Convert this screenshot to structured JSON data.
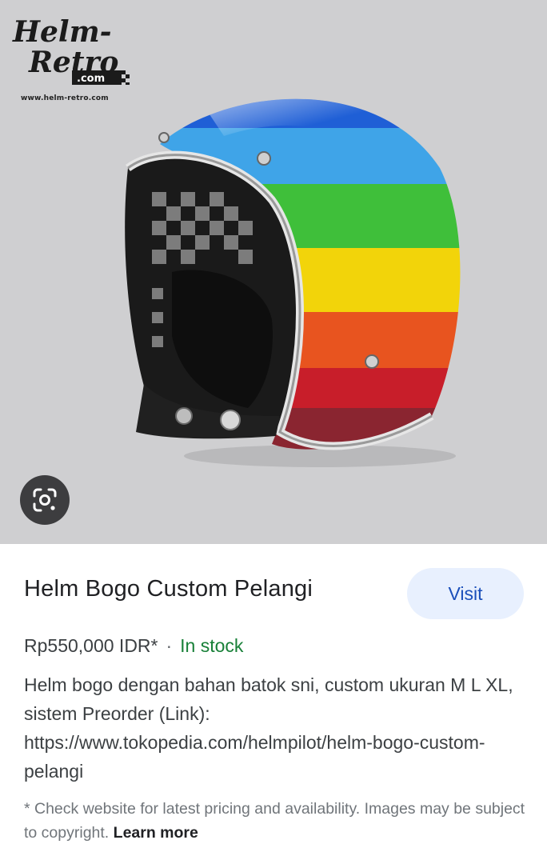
{
  "image": {
    "logo_text_line1": "Helm-",
    "logo_text_line2": "Retro",
    "logo_text_com": ".com",
    "logo_url": "www.helm-retro.com",
    "lens_icon": "google-lens-icon"
  },
  "result": {
    "title": "Helm Bogo Custom Pelangi",
    "visit_label": "Visit",
    "price": "Rp550,000 IDR*",
    "separator": "·",
    "stock": "In stock",
    "description": "Helm bogo dengan bahan batok sni, custom ukuran M L XL, sistem Preorder (Link): https://www.tokopedia.com/helmpilot/helm-bogo-custom-pelangi",
    "disclaimer": "* Check website for latest pricing and availability. Images may be subject to copyright.",
    "learn_more": "Learn more"
  },
  "colors": {
    "image_background": "#cfcfd1",
    "visit_button_bg": "#e8f0fe",
    "visit_button_text": "#1a4fba",
    "in_stock": "#188038",
    "helmet_stripes": [
      "#1f5fd6",
      "#3fa4e8",
      "#3fbf3a",
      "#f2d40a",
      "#e8541f",
      "#c81e2a",
      "#8a2530"
    ]
  }
}
